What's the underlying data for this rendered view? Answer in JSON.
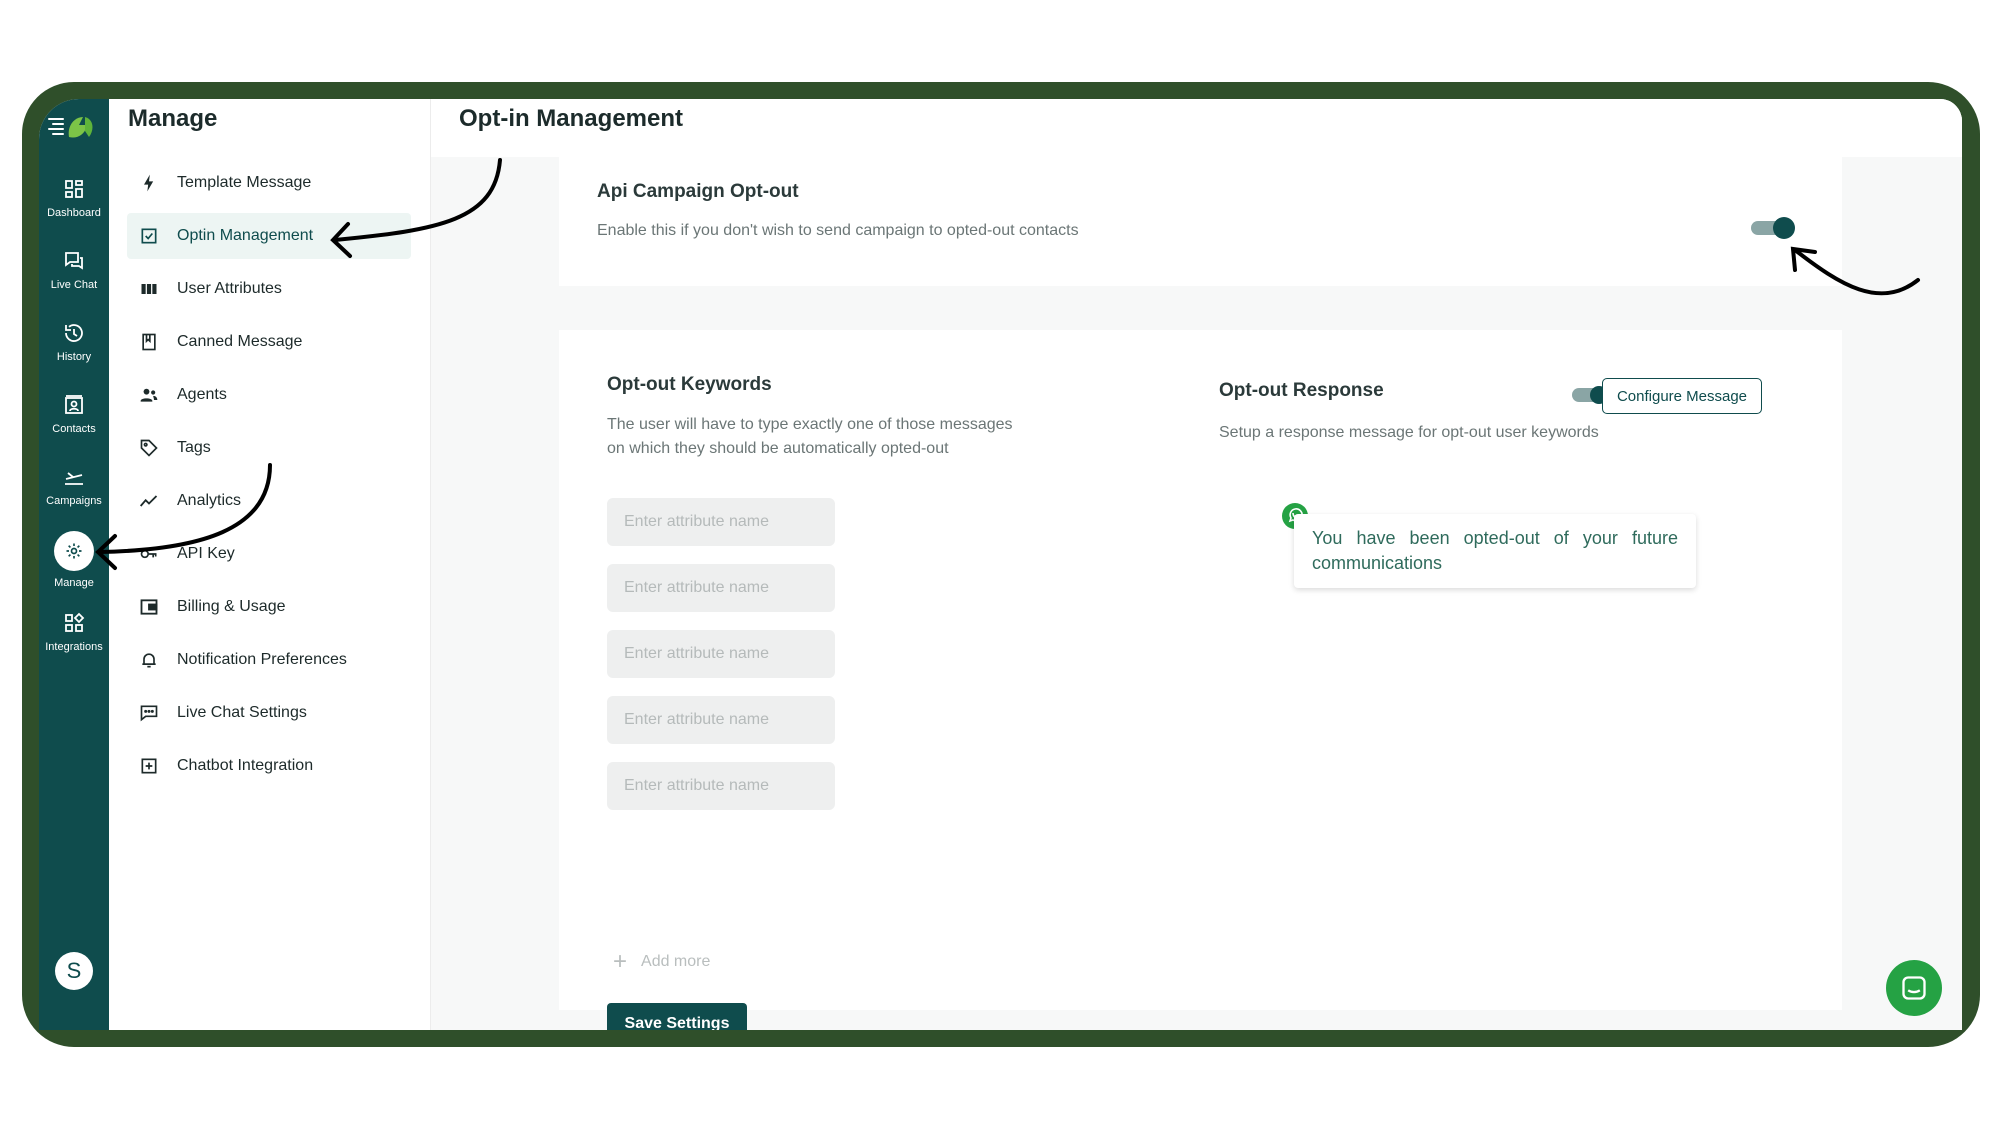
{
  "rail": {
    "items": [
      {
        "label": "Dashboard",
        "icon": "grid-icon"
      },
      {
        "label": "Live Chat",
        "icon": "chat-icon"
      },
      {
        "label": "History",
        "icon": "history-icon"
      },
      {
        "label": "Contacts",
        "icon": "contacts-icon"
      },
      {
        "label": "Campaigns",
        "icon": "plane-icon"
      },
      {
        "label": "Manage",
        "icon": "gear-icon"
      },
      {
        "label": "Integrations",
        "icon": "integrations-icon"
      }
    ],
    "active": "Manage",
    "avatar_initial": "S"
  },
  "manage": {
    "title": "Manage",
    "items": [
      {
        "label": "Template Message",
        "icon": "bolt-icon"
      },
      {
        "label": "Optin Management",
        "icon": "checkbox-icon"
      },
      {
        "label": "User Attributes",
        "icon": "columns-icon"
      },
      {
        "label": "Canned Message",
        "icon": "bookmark-icon"
      },
      {
        "label": "Agents",
        "icon": "people-icon"
      },
      {
        "label": "Tags",
        "icon": "tag-icon"
      },
      {
        "label": "Analytics",
        "icon": "trend-icon"
      },
      {
        "label": "API Key",
        "icon": "key-icon"
      },
      {
        "label": "Billing & Usage",
        "icon": "wallet-icon"
      },
      {
        "label": "Notification Preferences",
        "icon": "bell-icon"
      },
      {
        "label": "Live Chat Settings",
        "icon": "message-icon"
      },
      {
        "label": "Chatbot Integration",
        "icon": "bot-icon"
      }
    ],
    "active": "Optin Management"
  },
  "main": {
    "title": "Opt-in Management",
    "api_campaign": {
      "title": "Api Campaign Opt-out",
      "subtitle": "Enable this if you don't wish to send campaign to opted-out contacts",
      "enabled": true
    },
    "keywords": {
      "title": "Opt-out Keywords",
      "subtitle_line1": "The user will have to type exactly one of those messages",
      "subtitle_line2": "on which they should be automatically opted-out",
      "inputs": [
        {
          "placeholder": "Enter attribute name",
          "value": ""
        },
        {
          "placeholder": "Enter attribute name",
          "value": ""
        },
        {
          "placeholder": "Enter attribute name",
          "value": ""
        },
        {
          "placeholder": "Enter attribute name",
          "value": ""
        },
        {
          "placeholder": "Enter attribute name",
          "value": ""
        }
      ],
      "add_more": "Add more",
      "save": "Save Settings"
    },
    "response": {
      "title": "Opt-out Response",
      "subtitle": "Setup a response message for opt-out user keywords",
      "enabled": true,
      "configure": "Configure Message",
      "message": "You have been opted-out of your future communications"
    }
  },
  "colors": {
    "frame": "#2f4f2a",
    "brand": "#0f4c4d",
    "whatsapp": "#25a244"
  }
}
